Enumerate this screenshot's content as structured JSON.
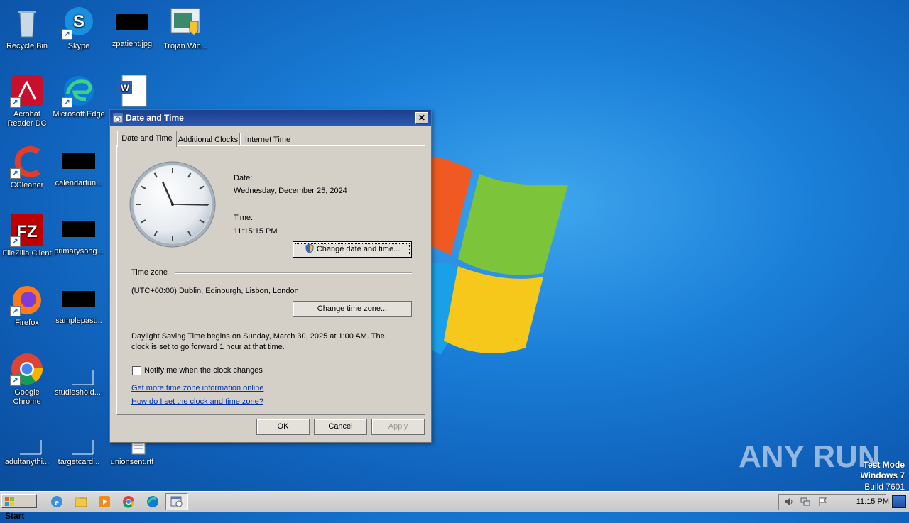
{
  "desktop": {
    "icons": [
      {
        "label": "Recycle Bin"
      },
      {
        "label": "Skype"
      },
      {
        "label": "zpatient.jpg"
      },
      {
        "label": "Trojan.Win..."
      },
      {
        "label": "Acrobat Reader DC"
      },
      {
        "label": "Microsoft Edge"
      },
      {
        "label": "CCleaner"
      },
      {
        "label": "calendarfun..."
      },
      {
        "label": "FileZilla Client"
      },
      {
        "label": "primarysong..."
      },
      {
        "label": "Firefox"
      },
      {
        "label": "samplepast..."
      },
      {
        "label": "Google Chrome"
      },
      {
        "label": "studieshold...."
      },
      {
        "label": "adultanythi..."
      },
      {
        "label": "targetcard..."
      },
      {
        "label": "unionsent.rtf"
      }
    ],
    "watermark": {
      "brand": "ANY RUN",
      "line1": "Test Mode",
      "line2": "Windows 7",
      "line3": "Build 7601"
    }
  },
  "dialog": {
    "title": "Date and Time",
    "close_label": "✕",
    "tabs": [
      "Date and Time",
      "Additional Clocks",
      "Internet Time"
    ],
    "date_label": "Date:",
    "date_value": "Wednesday, December 25, 2024",
    "time_label": "Time:",
    "time_value": "11:15:15 PM",
    "change_datetime_btn": "Change date and time...",
    "timezone_heading": "Time zone",
    "timezone_value": "(UTC+00:00) Dublin, Edinburgh, Lisbon, London",
    "change_tz_btn": "Change time zone...",
    "dst_text_1": "Daylight Saving Time begins on Sunday, March 30, 2025 at 1:00 AM. The",
    "dst_text_2": "clock is set to go forward 1 hour at that time.",
    "notify_label": "Notify me when the clock changes",
    "notify_checked": false,
    "link1": "Get more time zone information online",
    "link2": "How do I set the clock and time zone?",
    "ok": "OK",
    "cancel": "Cancel",
    "apply": "Apply"
  },
  "taskbar": {
    "start": "Start",
    "clock": "11:15 PM"
  }
}
